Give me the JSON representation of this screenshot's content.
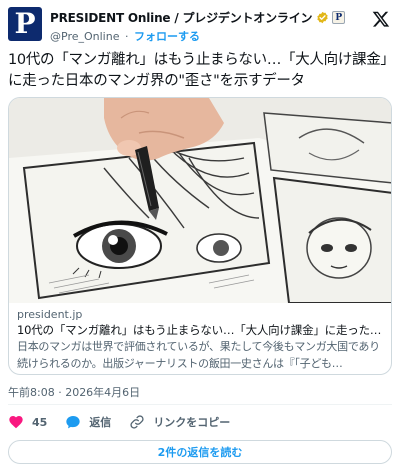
{
  "author": {
    "avatar_letter": "P",
    "display_name": "PRESIDENT Online / プレジデントオンライン",
    "handle": "@Pre_Online",
    "separator": "·",
    "follow_label": "フォローする",
    "affiliate_letter": "P",
    "avatar_color": "#0d2a6e"
  },
  "tweet": {
    "text": "10代の「マンガ離れ」はもう止まらない…「大人向け課金」に走った日本のマンガ界の\"歪さ\"を示すデータ"
  },
  "card": {
    "image_description_icon": "manga-drawing-image",
    "domain": "president.jp",
    "title": "10代の「マンガ離れ」はもう止まらない…「大人向け課金」に走った日本の…",
    "description": "日本のマンガは世界で評価されているが、果たして今後もマンガ大国であり続けられるのか。出版ジャーナリストの飯田一史さんは『「子ども…"
  },
  "timestamp": "午前8:08 · 2026年4月6日",
  "actions": {
    "like_count": "45",
    "reply_label": "返信",
    "copy_link_label": "リンクをコピー"
  },
  "read_replies_label": "2件の返信を読む",
  "colors": {
    "accent": "#1d9bf0",
    "like": "#f91880",
    "text": "#0f1419",
    "secondary": "#536471",
    "border": "#cfd9de"
  }
}
